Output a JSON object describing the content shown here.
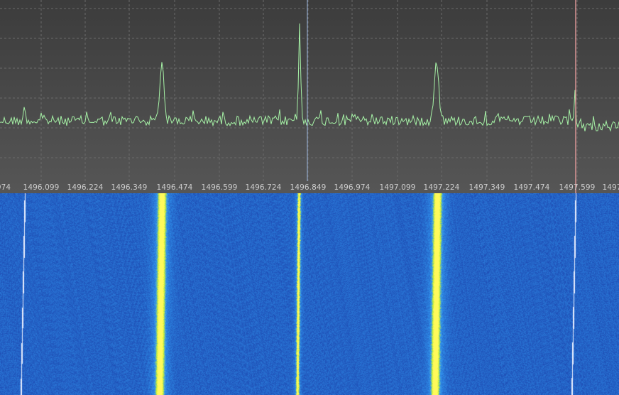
{
  "spectrum": {
    "trace_color": "#a6f2a6",
    "grid_color": "#6a6a6a",
    "background_top": "#3c3c3c",
    "background_bottom": "#565656",
    "center_marker_color": "#9eb8e0",
    "cursor_marker_color": "#e39a9a"
  },
  "frequency_axis": {
    "labels": [
      {
        "id": "f0",
        "text": "974"
      },
      {
        "id": "f1",
        "text": "1496.099"
      },
      {
        "id": "f2",
        "text": "1496.224"
      },
      {
        "id": "f3",
        "text": "1496.349"
      },
      {
        "id": "f4",
        "text": "1496.474"
      },
      {
        "id": "f5",
        "text": "1496.599"
      },
      {
        "id": "f6",
        "text": "1496.724"
      },
      {
        "id": "f7",
        "text": "1496.849"
      },
      {
        "id": "f8",
        "text": "1496.974"
      },
      {
        "id": "f9",
        "text": "1497.099"
      },
      {
        "id": "f10",
        "text": "1497.224"
      },
      {
        "id": "f11",
        "text": "1497.349"
      },
      {
        "id": "f12",
        "text": "1497.474"
      },
      {
        "id": "f13",
        "text": "1497.599"
      },
      {
        "id": "f14",
        "text": "1497"
      }
    ]
  },
  "signals": [
    {
      "name": "carrier-1496.099",
      "strength": "weak"
    },
    {
      "name": "carrier-1496.474",
      "strength": "strong"
    },
    {
      "name": "carrier-1496.849",
      "strength": "strong"
    },
    {
      "name": "carrier-1497.224",
      "strength": "strong"
    },
    {
      "name": "carrier-1497.599",
      "strength": "weak"
    }
  ],
  "waterfall": {
    "background_color": "#1a2fa0",
    "signal_color": "#f2f25a",
    "line_color": "#ffffff"
  }
}
